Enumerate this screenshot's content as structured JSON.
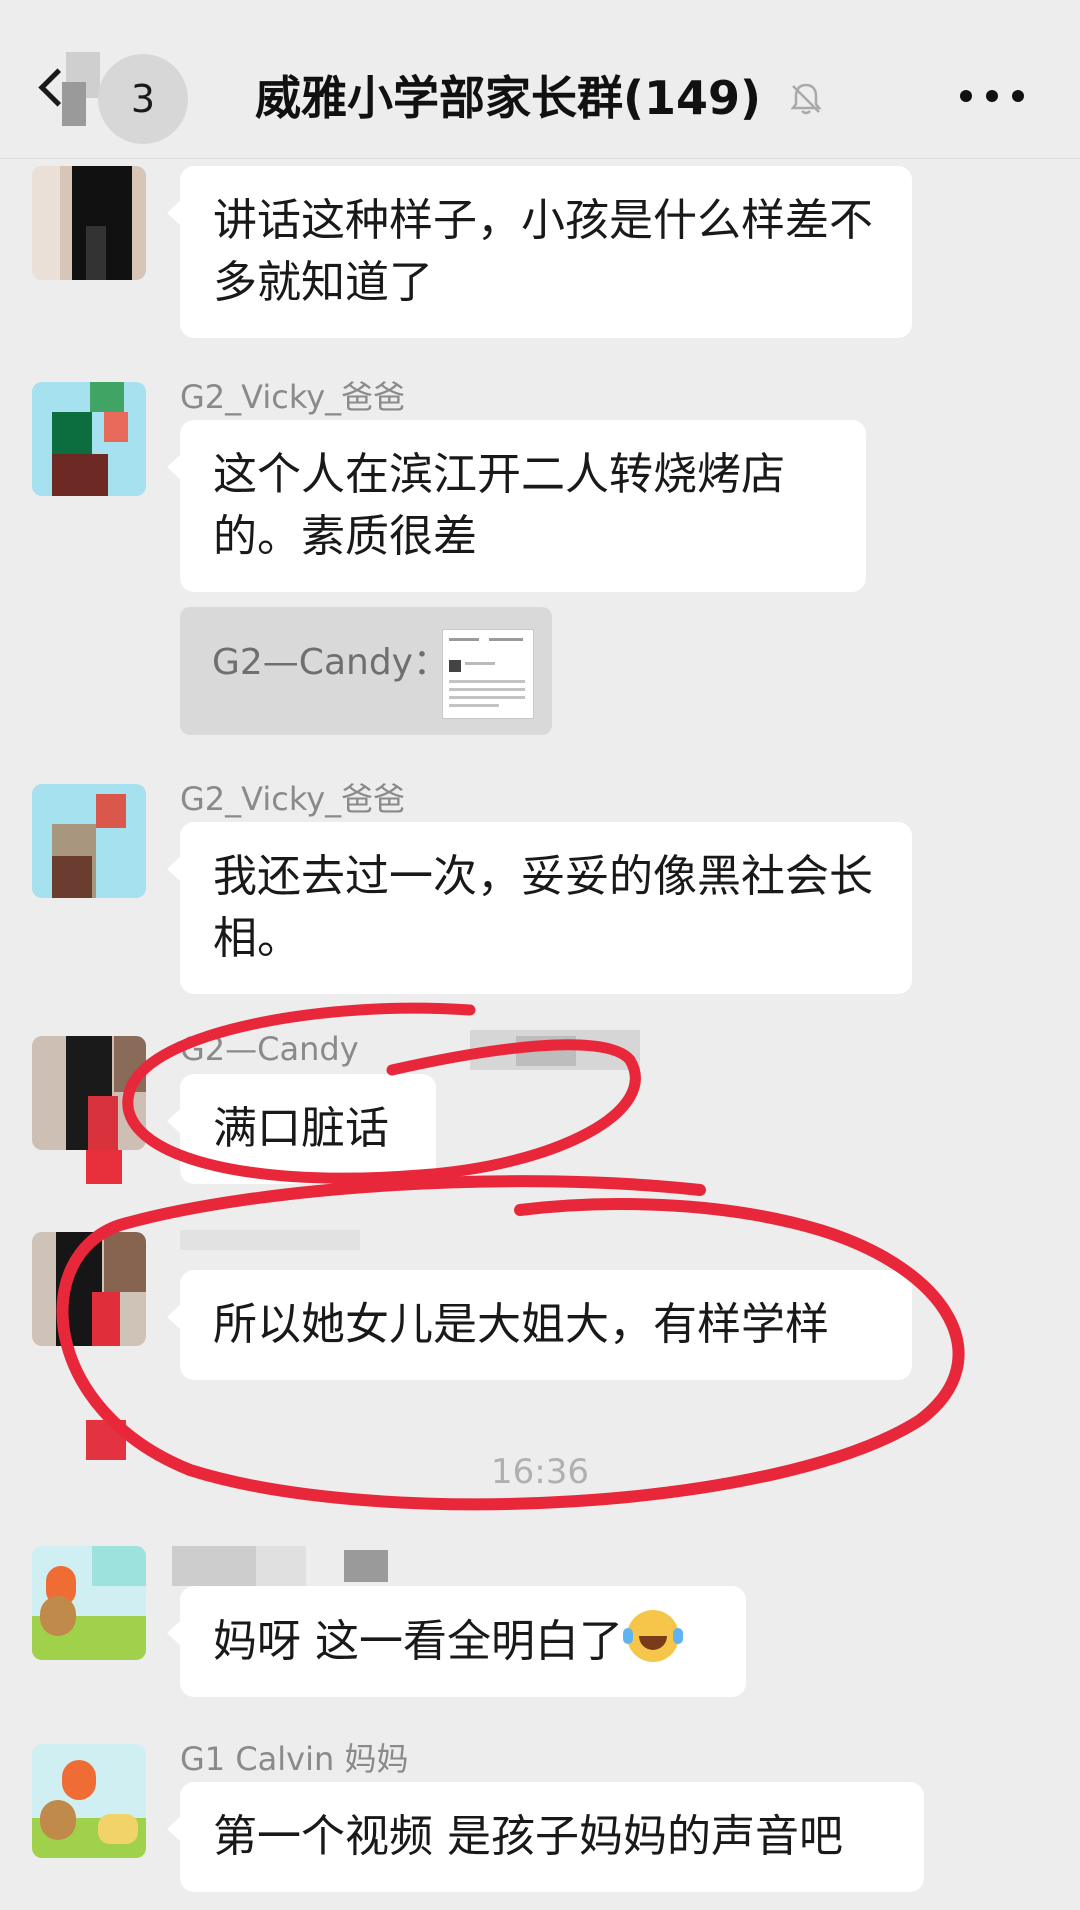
{
  "header": {
    "back_count": "3",
    "title": "威雅小学部家长群(149)",
    "mute_icon": "bell-slash-icon",
    "more_icon": "more-dots-icon"
  },
  "messages": [
    {
      "sender": "",
      "text": "讲话这种样子，小孩是什么样差不多就知道了"
    },
    {
      "sender": "G2_Vicky_爸爸",
      "text": "这个人在滨江开二人转烧烤店的。素质很差"
    },
    {
      "quote_label": "G2—Candy："
    },
    {
      "sender": "G2_Vicky_爸爸",
      "text": "我还去过一次，妥妥的像黑社会长相。"
    },
    {
      "sender": "G2—Candy",
      "text": "满口脏话"
    },
    {
      "sender": "",
      "text": "所以她女儿是大姐大，有样学样"
    },
    {
      "sender": "",
      "text": "妈呀 这一看全明白了",
      "emoji": "face-with-tears-of-joy-icon"
    },
    {
      "sender": "G1 Calvin 妈妈",
      "text": "第一个视频 是孩子妈妈的声音吧"
    }
  ],
  "timestamp": "16:36",
  "colors": {
    "background": "#ededed",
    "bubble": "#ffffff",
    "annotation_red": "#e8283a",
    "meta_text": "#8a8a8a"
  }
}
